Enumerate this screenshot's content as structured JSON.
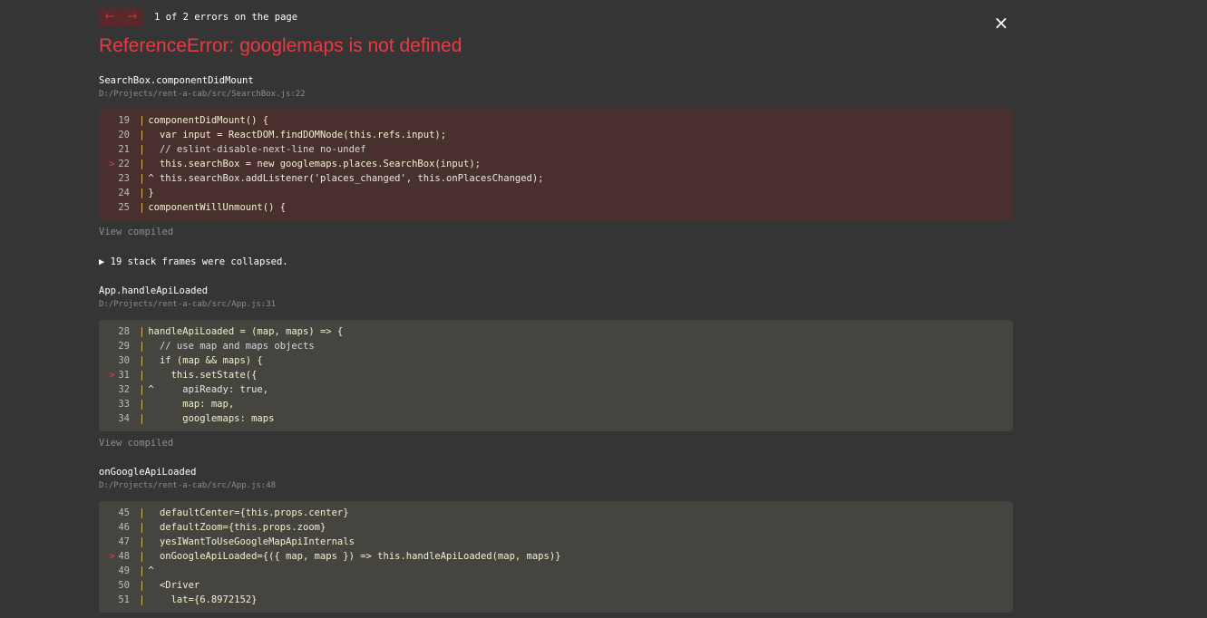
{
  "nav": {
    "prev_label": "←",
    "next_label": "→",
    "counter": "1 of 2 errors on the page"
  },
  "close_label": "×",
  "error_title": "ReferenceError: googlemaps is not defined",
  "frames": [
    {
      "name": "SearchBox.componentDidMount",
      "path": "D:/Projects/rent-a-cab/src/SearchBox.js:22",
      "lines": [
        {
          "num": "19",
          "marker": "",
          "text": "componentDidMount() {"
        },
        {
          "num": "20",
          "marker": "",
          "text": "  var input = ReactDOM.findDOMNode(this.refs.input);"
        },
        {
          "num": "21",
          "marker": "",
          "text": "  // eslint-disable-next-line no-undef"
        },
        {
          "num": "22",
          "marker": ">",
          "text": "  this.searchBox = new googlemaps.places.SearchBox(input);"
        },
        {
          "num": "23",
          "marker": "",
          "text": "^ this.searchBox.addListener('places_changed', this.onPlacesChanged);"
        },
        {
          "num": "24",
          "marker": "",
          "text": "}"
        },
        {
          "num": "25",
          "marker": "",
          "text": "componentWillUnmount() {"
        }
      ]
    },
    {
      "name": "App.handleApiLoaded",
      "path": "D:/Projects/rent-a-cab/src/App.js:31",
      "lines": [
        {
          "num": "28",
          "marker": "",
          "text": "handleApiLoaded = (map, maps) => {"
        },
        {
          "num": "29",
          "marker": "",
          "text": "  // use map and maps objects"
        },
        {
          "num": "30",
          "marker": "",
          "text": "  if (map && maps) {"
        },
        {
          "num": "31",
          "marker": ">",
          "text": "    this.setState({"
        },
        {
          "num": "32",
          "marker": "",
          "text": "^     apiReady: true,"
        },
        {
          "num": "33",
          "marker": "",
          "text": "      map: map,"
        },
        {
          "num": "34",
          "marker": "",
          "text": "      googlemaps: maps"
        }
      ]
    },
    {
      "name": "onGoogleApiLoaded",
      "path": "D:/Projects/rent-a-cab/src/App.js:48",
      "lines": [
        {
          "num": "45",
          "marker": "",
          "text": "  defaultCenter={this.props.center}"
        },
        {
          "num": "46",
          "marker": "",
          "text": "  defaultZoom={this.props.zoom}"
        },
        {
          "num": "47",
          "marker": "",
          "text": "  yesIWantToUseGoogleMapApiInternals"
        },
        {
          "num": "48",
          "marker": ">",
          "text": "  onGoogleApiLoaded={({ map, maps }) => this.handleApiLoaded(map, maps)}"
        },
        {
          "num": "49",
          "marker": "",
          "text": "^"
        },
        {
          "num": "50",
          "marker": "",
          "text": "  <Driver"
        },
        {
          "num": "51",
          "marker": "",
          "text": "    lat={6.8972152}"
        }
      ]
    }
  ],
  "view_compiled": "View compiled",
  "collapsed": "▶ 19 stack frames were collapsed.",
  "colors": {
    "background": "#353535",
    "error_red": "#e83b46",
    "error_block": "#4a2f2f",
    "code_block": "#45443f"
  }
}
